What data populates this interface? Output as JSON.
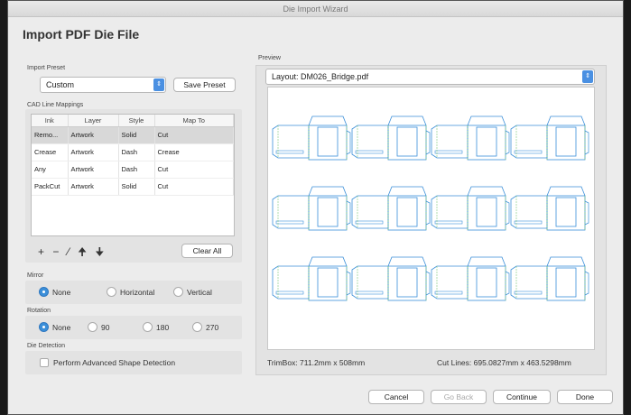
{
  "window": {
    "title": "Die Import Wizard"
  },
  "heading": "Import PDF Die File",
  "import_preset": {
    "label": "Import Preset",
    "value": "Custom",
    "save_label": "Save Preset"
  },
  "cad": {
    "label": "CAD Line Mappings",
    "columns": [
      "Ink",
      "Layer",
      "Style",
      "Map To"
    ],
    "rows": [
      {
        "ink": "Remo...",
        "layer": "Artwork",
        "style": "Solid",
        "map": "Cut"
      },
      {
        "ink": "Crease",
        "layer": "Artwork",
        "style": "Dash",
        "map": "Crease"
      },
      {
        "ink": "Any",
        "layer": "Artwork",
        "style": "Dash",
        "map": "Cut"
      },
      {
        "ink": "PackCut",
        "layer": "Artwork",
        "style": "Solid",
        "map": "Cut"
      }
    ],
    "toolbar_icons": [
      "plus-icon",
      "minus-icon",
      "pen-icon",
      "arrow-up-icon",
      "arrow-down-icon"
    ],
    "toolbar_glyphs": {
      "plus": "+",
      "minus": "−",
      "pen": "⁄",
      "up": "🠉",
      "down": "🠋"
    },
    "clear_label": "Clear All"
  },
  "mirror": {
    "label": "Mirror",
    "options": [
      "None",
      "Horizontal",
      "Vertical"
    ],
    "selected": "None"
  },
  "rotation": {
    "label": "Rotation",
    "options": [
      "None",
      "90",
      "180",
      "270"
    ],
    "selected": "None"
  },
  "die_detection": {
    "label": "Die Detection",
    "checkbox": "Perform Advanced Shape Detection",
    "checked": false
  },
  "preview": {
    "label": "Preview",
    "layout": "Layout: DM026_Bridge.pdf",
    "trimbox": "TrimBox: 711.2mm x 508mm",
    "cutlines": "Cut Lines: 695.0827mm x 463.5298mm",
    "cut_color": "#3b8fd9",
    "crease_color": "#7ec97a"
  },
  "footer": {
    "cancel": "Cancel",
    "back": "Go Back",
    "continue": "Continue",
    "done": "Done"
  }
}
